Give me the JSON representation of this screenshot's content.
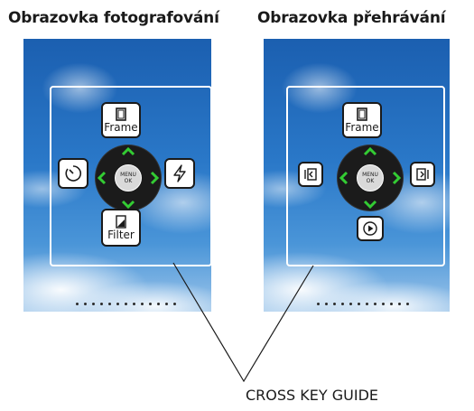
{
  "titles": {
    "shooting": "Obrazovka fotografování",
    "playback": "Obrazovka přehrávání"
  },
  "shooting_keys": {
    "top": {
      "icon": "frame-icon",
      "label": "Frame"
    },
    "left": {
      "icon": "self-timer-icon"
    },
    "right": {
      "icon": "flash-icon"
    },
    "bottom": {
      "icon": "filter-icon",
      "label": "Filter"
    }
  },
  "playback_keys": {
    "top": {
      "icon": "frame-icon",
      "label": "Frame"
    },
    "left": {
      "icon": "previous-image-icon"
    },
    "right": {
      "icon": "next-image-icon"
    },
    "bottom": {
      "icon": "play-icon"
    }
  },
  "dial": {
    "line1": "MENU",
    "line2": "OK"
  },
  "caption": "CROSS KEY GUIDE",
  "colors": {
    "arrow": "#33cc33",
    "dial": "#1b1b1b",
    "sky": "#2a78c8"
  }
}
